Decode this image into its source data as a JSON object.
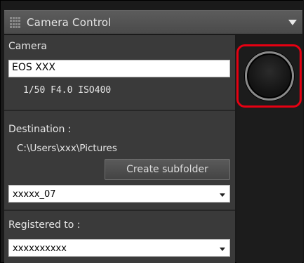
{
  "panel": {
    "title": "Camera Control",
    "icons": {
      "grip": "grip-icon",
      "collapse": "collapse-arrow-icon"
    }
  },
  "camera": {
    "label": "Camera",
    "name": "EOS XXX",
    "settings": "1/50  F4.0  ISO400"
  },
  "destination": {
    "label": "Destination :",
    "path": "C:\\Users\\xxx\\Pictures",
    "create_subfolder_label": "Create subfolder",
    "subfolder_selected": "xxxxx_07"
  },
  "registered": {
    "label": "Registered to :",
    "selected": "xxxxxxxxxx"
  },
  "colors": {
    "highlight": "#e60012",
    "panel_bg": "#3a3a3a",
    "side_bg": "#1c1c1c"
  }
}
